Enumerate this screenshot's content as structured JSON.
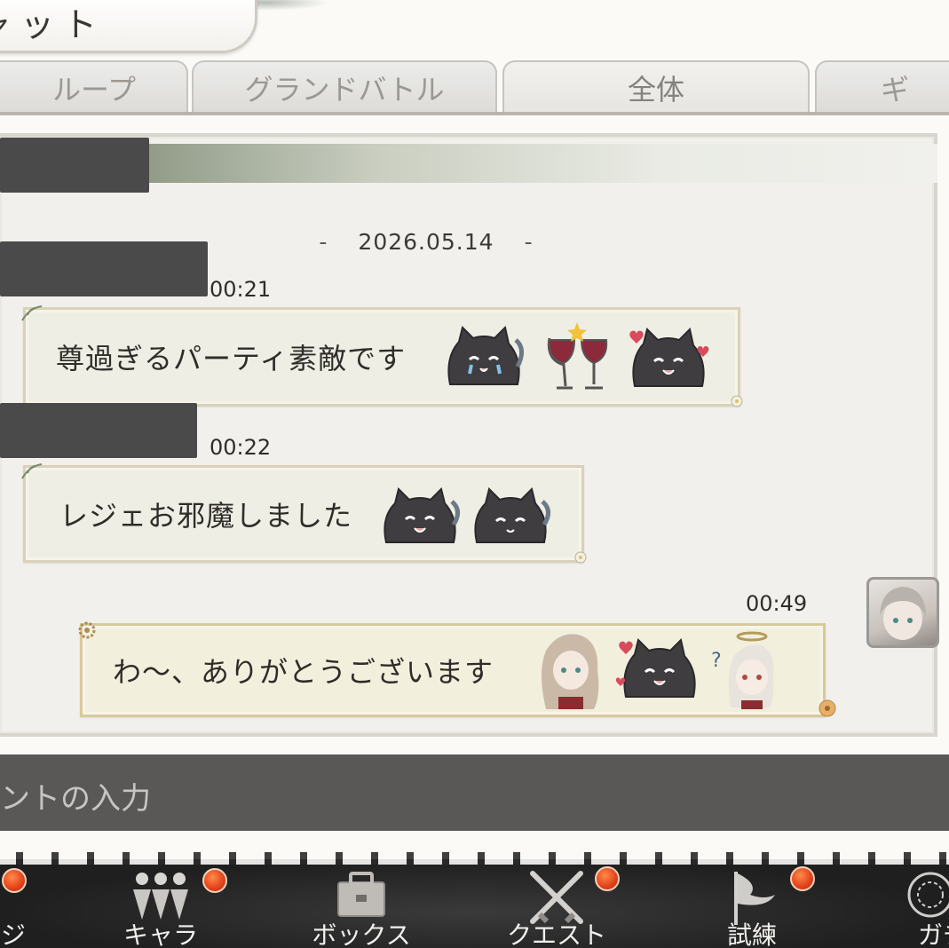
{
  "header": {
    "title": "ャット"
  },
  "tabs": [
    {
      "label": "ループ",
      "active": false
    },
    {
      "label": "グランドバトル",
      "active": false
    },
    {
      "label": "全体",
      "active": true
    },
    {
      "label": "ギ",
      "active": false
    }
  ],
  "chat": {
    "date": "2026.05.14",
    "date_dash": "-",
    "messages": [
      {
        "time": "00:21",
        "text": "尊過ぎるパーティ素敵です",
        "stamps": [
          "crying-slime-cat-sticker",
          "wine-glasses-sticker",
          "happy-slime-cat-hearts-sticker"
        ],
        "self": false
      },
      {
        "time": "00:22",
        "text": "レジェお邪魔しました",
        "stamps": [
          "smiling-slime-cat-sticker",
          "content-slime-cat-sticker"
        ],
        "self": false
      },
      {
        "time": "00:49",
        "text": "わ〜、ありがとうございます",
        "stamps": [
          "long-haired-girl-sticker",
          "happy-slime-cat-hearts-sticker",
          "confused-girl-halo-sticker"
        ],
        "self": true
      }
    ]
  },
  "input": {
    "placeholder": "ントの入力"
  },
  "nav": {
    "items": [
      {
        "label": "ジ",
        "icon": "home-icon",
        "badge": true
      },
      {
        "label": "キャラ",
        "icon": "characters-icon",
        "badge": true
      },
      {
        "label": "ボックス",
        "icon": "box-icon",
        "badge": false
      },
      {
        "label": "クエスト",
        "icon": "crossed-swords-icon",
        "badge": true
      },
      {
        "label": "試練",
        "icon": "flag-icon",
        "badge": true
      },
      {
        "label": "ガチ",
        "icon": "gacha-circle-icon",
        "badge": false
      }
    ]
  },
  "colors": {
    "badge": "#e2401a",
    "bubble_bg": "#efeee4",
    "nav_bg": "#262626"
  }
}
